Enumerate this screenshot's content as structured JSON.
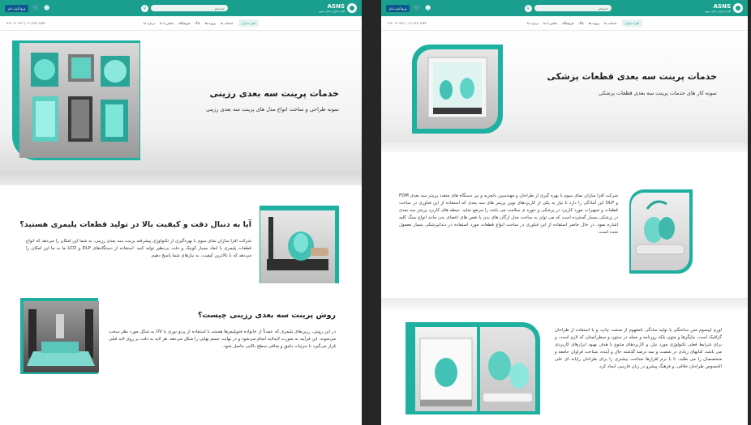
{
  "header": {
    "logo_text": "ASNS",
    "logo_sub": "افزا سازان نمای سوم",
    "search_placeholder": "جستجو",
    "login_label": "ورود/ثبت نام"
  },
  "nav": {
    "items": [
      "افزا سازان",
      "خدمات ما",
      "پروژه ها",
      "بلاگ",
      "فروشگاه",
      "تماس با ما",
      "درباره ما"
    ],
    "contact": "۰۹۱۲۰۱۲۰۴۶۲ | ۰۲۱-۶۶۷۰۲۸۳۴"
  },
  "left_page": {
    "hero_title": "خدمات پرینت سه بعدی رزینی",
    "hero_subtitle": "نمونه طراحی و ساخت انواع مدل های پرینت سه بعدی رزینی",
    "section1_title": "آیا به دنبال دقت و کیفیت بالا در تولید قطعات پلیمری هستید؟",
    "section1_text": "شرکت افزا سازان نمای سوم با بهره‌گیری از تکنولوژی پیشرفته پرینت سه بعدی رزینی، به شما این امکان را می‌دهد که انواع قطعات پلیمری با ابعاد بسیار کوچک و دقت بی‌نظیر تولید کنید. استفاده از دستگاه‌های DLP و LCD ما به ما این امکان را می‌دهد که با بالاترین کیفیت، به نیازهای شما پاسخ دهیم.",
    "section2_title": "روش پرینت سه بعدی رزینی چیست؟",
    "section2_text": "در این روش، رزین‌های پلیمری که عمدتاً از خانواده فتوپلیمرها هستند با استفاده از پرتو نوری یا UV به شکل مورد نظر سخت می‌شوند. این فرآیند به صورت لایه‌لایه انجام می‌شود و در نهایت جسم نهایی را شکل می‌دهد. هر لایه به دقت بر روی لایه قبلی قرار می‌گیرد تا جزئیات دقیق و صافی سطح بالایی حاصل شود."
  },
  "right_page": {
    "hero_title": "خدمات پرینت سه بعدی قطعات پزشکی",
    "hero_subtitle": "نمونه کار های خدمات پرینت سه بعدی قطعات پزشکی",
    "section1_text": "شرکت افزا سازان نمای سوم با بهره گیری از طراحان و مهندسین باتجربه و نیز دستگاه های متعدد پرینتر سه بعدی FDM و DLP این آمادگی را دارد تا نیاز به یکی از کاربردهای نوین پرینتر های سه بعدی که استفاده از این فناوری در ساخت قطعات و تجهیزات مورد کاربرد در پزشکی و حوزه ی سلامت می باشد را مرتفع نماید. حیطه های کاربرد پرینتر سه بعدی در پزشکی بسیار گسترده است که می توان به ساخت مدل ارگان های بدن یا نقص های اعضای بدن مانند انواع سنگ کلیه اشاره نمود. در حال حاضر استفاده از این فناوری در ساخت انواع قطعات مورد استفاده در دندانپزشکی بسیار معمول شده است.",
    "section2_text": "لورم ایپسوم متن ساختگی با تولید سادگی نامفهوم از صنعت چاپ، و با استفاده از طراحان گرافیک است، چاپگرها و متون بلکه روزنامه و مجله در ستون و سطرآنچنان که لازم است، و برای شرایط فعلی تکنولوژی مورد نیاز، و کاربردهای متنوع با هدف بهبود ابزارهای کاربردی می باشد، کتابهای زیادی در شصت و سه درصد گذشته حال و آینده، شناخت فراوان جامعه و متخصصان را می طلبد، تا با نرم افزارها شناخت بیشتری را برای طراحان رایانه ای علی الخصوص طراحان خلاقی، و فرهنگ پیشرو در زبان فارسی ایجاد کرد."
  },
  "colors": {
    "brand": "#1a9e8e",
    "accent_frame": "#1eb0a0",
    "login": "#0d5b8c"
  }
}
